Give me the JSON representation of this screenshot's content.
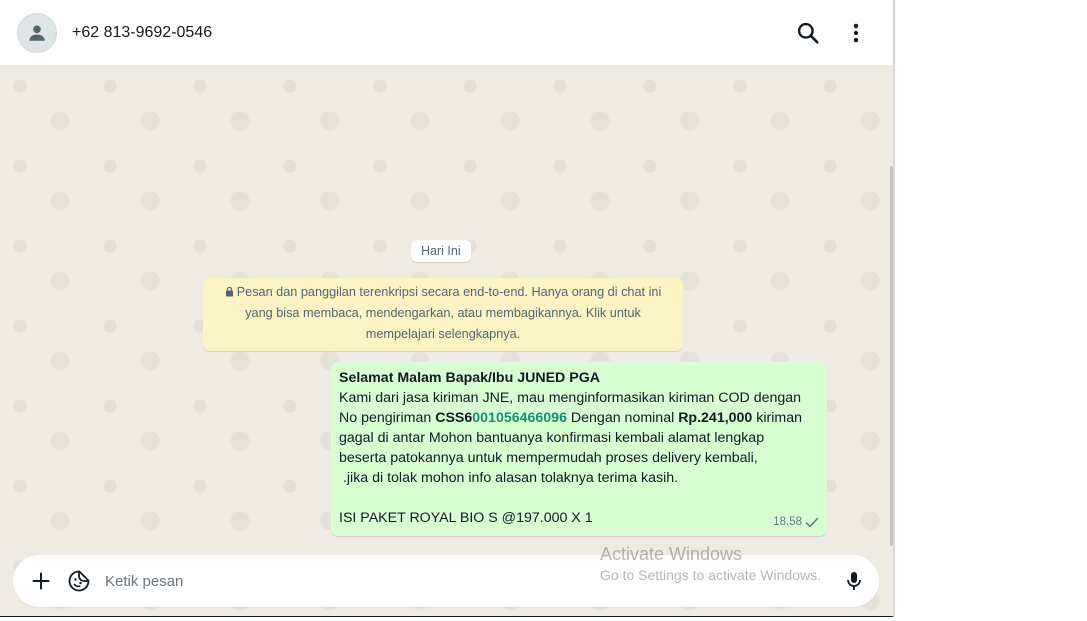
{
  "header": {
    "contact_name": "+62 813-9692-0546"
  },
  "chat": {
    "date_chip": "Hari Ini",
    "encryption_notice": "Pesan dan panggilan terenkripsi secara end-to-end. Hanya orang di chat ini yang bisa membaca, mendengarkan, atau membagikannya. Klik untuk mempelajari selengkapnya.",
    "message": {
      "greeting": "Selamat Malam Bapak/Ibu JUNED PGA",
      "line1": "Kami dari jasa kiriman JNE, mau menginformasikan kiriman COD dengan",
      "line2_prefix": "No pengiriman ",
      "tracking_prefix": "CSS6",
      "tracking_number": "001056466096",
      "line2_middle": " Dengan nominal ",
      "amount": "Rp.241,000",
      "line2_suffix": " kiriman",
      "line3": "gagal di antar Mohon bantuanya konfirmasi kembali alamat lengkap",
      "line4": "beserta patokannya untuk mempermudah proses delivery kembali,",
      "line5": " .jika di tolak mohon info alasan tolaknya terima kasih.",
      "line6": "ISI PAKET ROYAL BIO S @197.000 X 1",
      "time": "18.58",
      "status": "sent"
    }
  },
  "composer": {
    "placeholder": "Ketik pesan"
  },
  "watermark": {
    "title": "Activate Windows",
    "subtitle": "Go to Settings to activate Windows."
  },
  "icons": {
    "avatar": "person-icon",
    "search": "search-icon",
    "menu": "more-vertical-icon",
    "attach": "plus-icon",
    "sticker": "sticker-icon",
    "mic": "mic-icon",
    "lock": "lock-icon",
    "tick": "single-check-icon"
  },
  "colors": {
    "chat_background": "#efeae2",
    "outgoing_bubble": "#d9fdd3",
    "encryption_banner": "#fdf4c5",
    "tracking_link": "#168f6f"
  }
}
